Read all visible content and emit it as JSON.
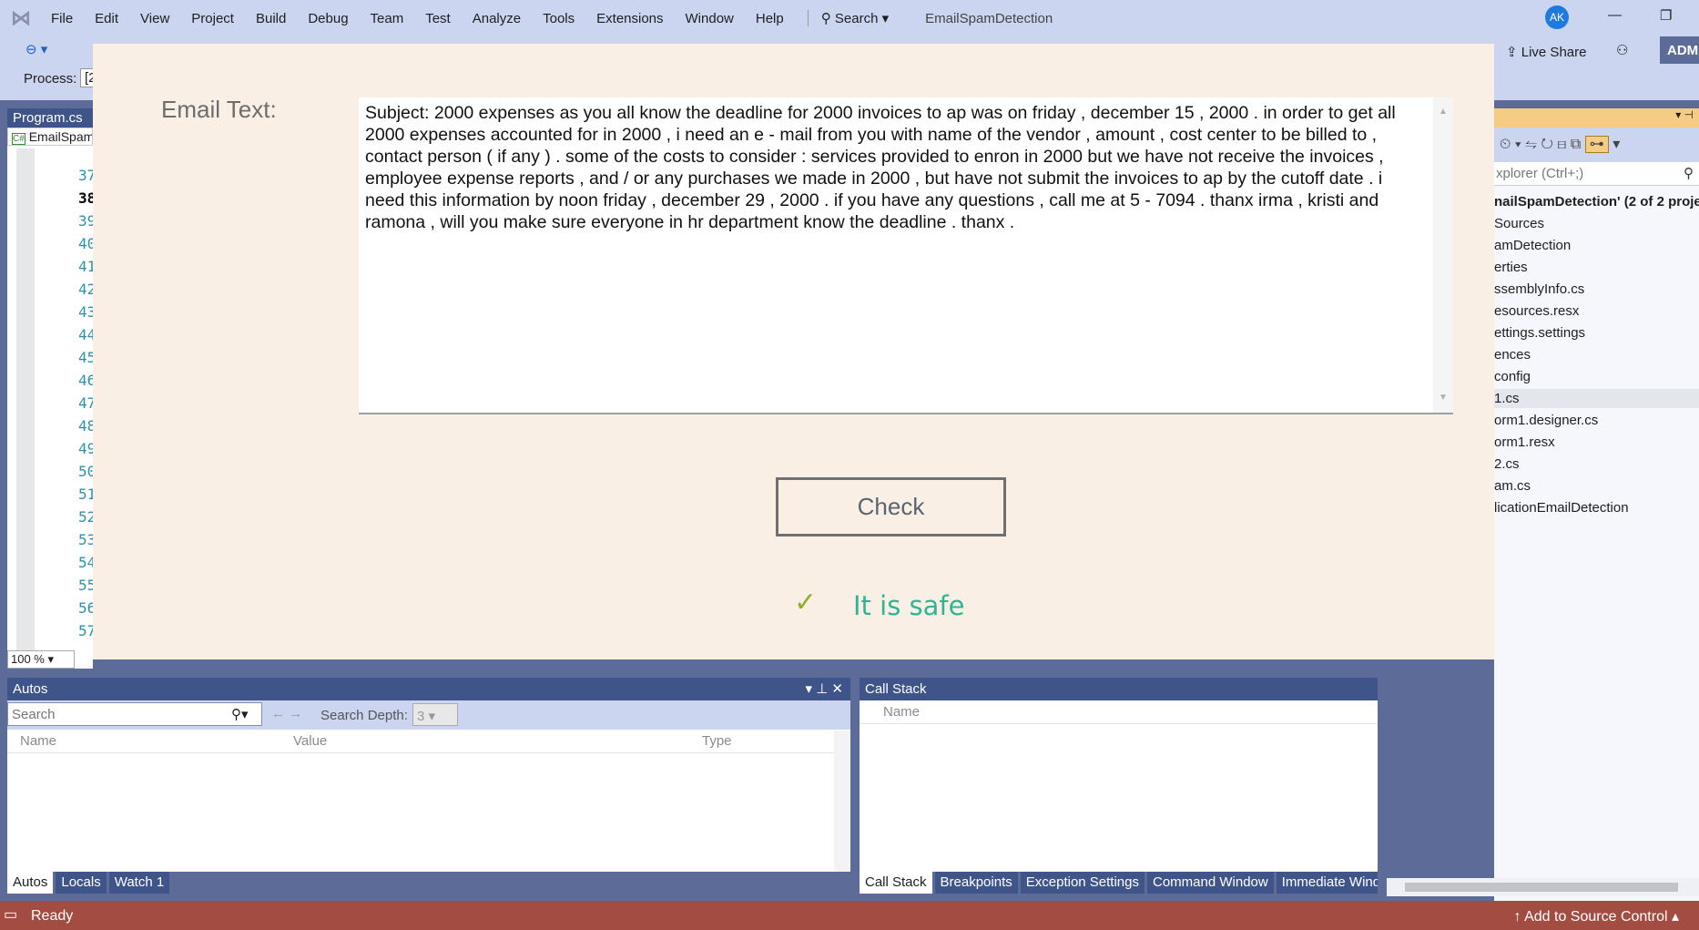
{
  "menu": {
    "items": [
      "File",
      "Edit",
      "View",
      "Project",
      "Build",
      "Debug",
      "Team",
      "Test",
      "Analyze",
      "Tools",
      "Extensions",
      "Window",
      "Help"
    ],
    "search": "Search",
    "solution_title": "EmailSpamDetection",
    "avatar": "AK"
  },
  "toolbar": {
    "process_label": "Process:",
    "process_value": "[2",
    "live_share": "Live Share",
    "admin": "ADM"
  },
  "editor": {
    "tab": "Program.cs",
    "nav": "EmailSpam",
    "line_numbers": [
      "37",
      "38",
      "39",
      "40",
      "41",
      "42",
      "43",
      "44",
      "45",
      "46",
      "47",
      "48",
      "49",
      "50",
      "51",
      "52",
      "53",
      "54",
      "55",
      "56",
      "57"
    ],
    "current_line": "38",
    "zoom": "100 %"
  },
  "dialog": {
    "email_label": "Email Text:",
    "email_text": "Subject: 2000 expenses  as you all know the deadline for 2000 invoices to ap was on friday , december  15 , 2000 . in order to get all 2000 expenses accounted for in 2000 , i need an  e - mail from you with name of the vendor , amount , cost center to be billed to ,  contact person ( if any ) . some of the costs to consider : services provided  to enron in 2000 but we have not receive the invoices , employee expense  reports , and / or any purchases we made in 2000 , but have not submit the  invoices to ap by the cutoff date . i need this information by noon friday ,  december 29 , 2000 . if you have any questions , call me at 5 - 7094 . thanx irma , kristi and ramona ,  will you make sure everyone in hr department know the deadline . thanx .",
    "check_button": "Check",
    "result": "It is safe",
    "result_color": "#2fb594",
    "check_color": "#8db028"
  },
  "autos": {
    "title": "Autos",
    "search_placeholder": "Search",
    "search_depth_label": "Search Depth:",
    "search_depth": "3",
    "columns": [
      "Name",
      "Value",
      "Type"
    ],
    "tabs": [
      "Autos",
      "Locals",
      "Watch 1"
    ]
  },
  "callstack": {
    "title": "Call Stack",
    "columns": [
      "Name"
    ],
    "tabs": [
      "Call Stack",
      "Breakpoints",
      "Exception Settings",
      "Command Window",
      "Immediate Windo"
    ]
  },
  "solution_explorer": {
    "search_placeholder": "xplorer (Ctrl+;)",
    "items": [
      "nailSpamDetection' (2 of 2 proje",
      "Sources",
      "amDetection",
      "erties",
      "ssemblyInfo.cs",
      "esources.resx",
      "ettings.settings",
      "ences",
      "config",
      "1.cs",
      "orm1.designer.cs",
      "orm1.resx",
      "2.cs",
      "am.cs",
      "licationEmailDetection"
    ],
    "selected_index": 9
  },
  "status": {
    "text": "Ready",
    "source_control": "Add to Source Control",
    "color": "#a34d42"
  }
}
